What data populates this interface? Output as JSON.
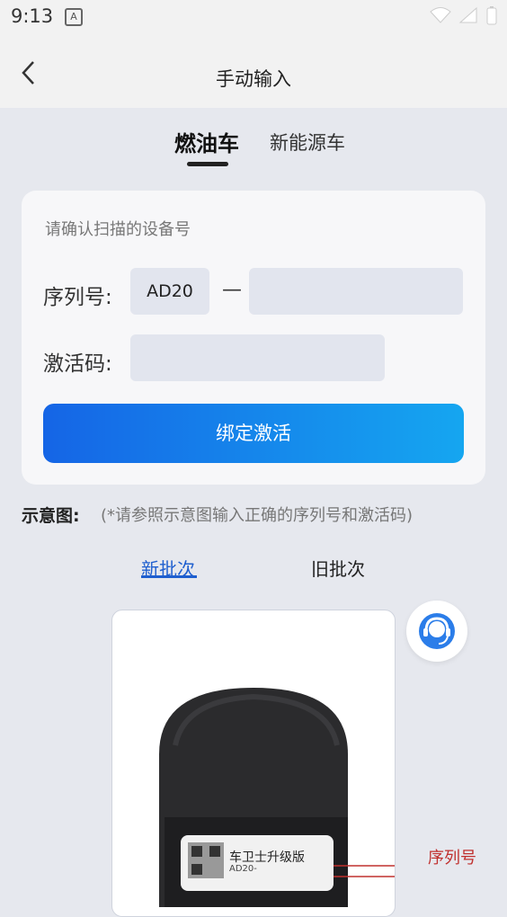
{
  "status_bar": {
    "time": "9:13",
    "notification_glyph": "A"
  },
  "header": {
    "title": "手动输入",
    "back_icon": "chevron-left-icon"
  },
  "tabs": [
    {
      "label": "燃油车",
      "active": true
    },
    {
      "label": "新能源车",
      "active": false
    }
  ],
  "form": {
    "hint": "请确认扫描的设备号",
    "serial_label": "序列号:",
    "serial_prefix": "AD20",
    "serial_separator": "—",
    "serial_value": "",
    "code_label": "激活码:",
    "code_value": "",
    "bind_button": "绑定激活"
  },
  "diagram": {
    "label": "示意图:",
    "note": "(*请参照示意图输入正确的序列号和激活码)",
    "batches": [
      {
        "label": "新批次",
        "active": true
      },
      {
        "label": "旧批次",
        "active": false
      }
    ],
    "device_label_title": "车卫士升级版",
    "device_label_serial": "AD20-",
    "annotation": "序列号"
  },
  "support_icon": "headset-support-icon",
  "colors": {
    "accent": "#1f5fcf",
    "button_start": "#1565e6",
    "button_end": "#15a6f0",
    "annotation": "#c0302e"
  }
}
